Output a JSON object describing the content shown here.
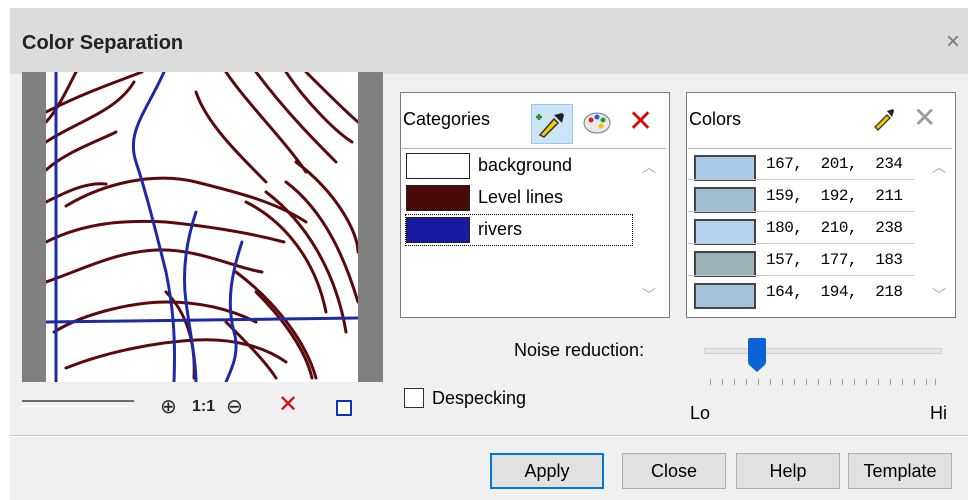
{
  "window": {
    "title": "Color Separation",
    "close_glyph": "×"
  },
  "preview": {
    "zoom_in_label": "⊕",
    "zoom_1to1_label": "1:1",
    "zoom_out_label": "⊖",
    "delete_label": "✕",
    "frame_label": ""
  },
  "categories": {
    "header": "Categories",
    "items": [
      {
        "label": "background",
        "color": "#ffffff"
      },
      {
        "label": "Level lines",
        "color": "#4a0a0a"
      },
      {
        "label": "rivers",
        "color": "#1a1aa0"
      }
    ]
  },
  "colors": {
    "header": "Colors",
    "items": [
      {
        "value": "167,  201,  234",
        "color": "#a7c9ea"
      },
      {
        "value": "159,  192,  211",
        "color": "#9fc0d3"
      },
      {
        "value": "180,  210,  238",
        "color": "#b4d2ee"
      },
      {
        "value": "157,  177,  183",
        "color": "#9db1b7"
      },
      {
        "value": "164,  194,  218",
        "color": "#a4c2da"
      }
    ]
  },
  "noise": {
    "label": "Noise reduction:",
    "lo": "Lo",
    "hi": "Hi",
    "level": 0.2
  },
  "despeckling": {
    "label": "Despecking",
    "checked": false
  },
  "buttons": {
    "apply": "Apply",
    "close": "Close",
    "help": "Help",
    "template": "Template"
  },
  "icons": {
    "picker": "eyedropper-icon",
    "palette": "palette-icon",
    "delete": "close-icon"
  },
  "accent": "#0078d7"
}
